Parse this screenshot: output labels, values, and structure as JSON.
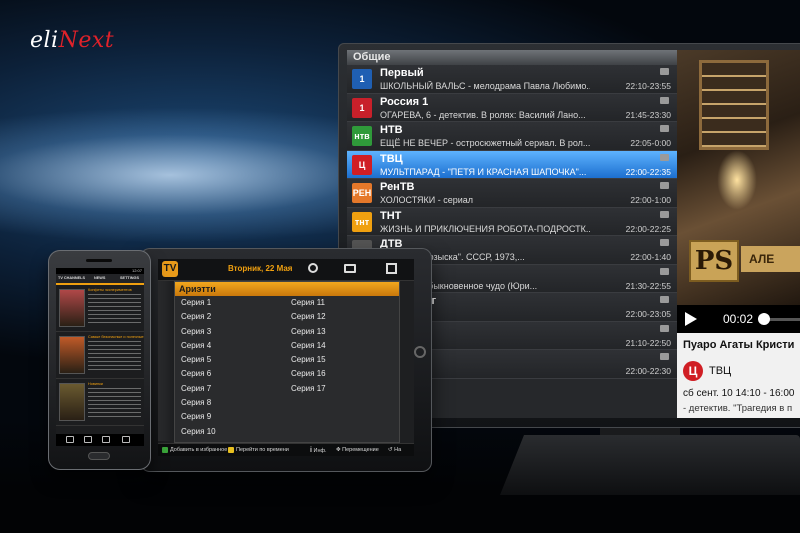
{
  "brand": {
    "logo_prefix": "eli",
    "logo_suffix": "Next"
  },
  "tv": {
    "list_header": "Общие",
    "channels": [
      {
        "name": "Первый",
        "program": "ШКОЛЬНЫЙ ВАЛЬС - мелодрама Павла Любимо...",
        "time": "22:10-23:55",
        "icon_text": "1",
        "icon_color": "#1f5fb3"
      },
      {
        "name": "Россия 1",
        "program": "ОГАРЕВА, 6 - детектив. В ролях: Василий Лано...",
        "time": "21:45-23:30",
        "icon_text": "1",
        "icon_color": "#c8202a"
      },
      {
        "name": "НТВ",
        "program": "ЕЩЁ НЕ ВЕЧЕР - остросюжетный сериал. В рол...",
        "time": "22:05-0:00",
        "icon_text": "нтв",
        "icon_color": "#2f9a3a"
      },
      {
        "name": "ТВЦ",
        "program": "МУЛЬТПАРАД - \"ПЕТЯ И КРАСНАЯ ШАПОЧКА\"...",
        "time": "22:00-22:35",
        "icon_text": "Ц",
        "icon_color": "#d01e24"
      },
      {
        "name": "РенТВ",
        "program": "ХОЛОСТЯКИ - сериал",
        "time": "22:00-1:00",
        "icon_text": "РЕН",
        "icon_color": "#e5782a"
      },
      {
        "name": "ТНТ",
        "program": "ЖИЗНЬ И ПРИКЛЮЧЕНИЯ РОБОТА-ПОДРОСТК...",
        "time": "22:00-22:25",
        "icon_text": "тнт",
        "icon_color": "#f0a010"
      },
      {
        "name": "ДТВ",
        "program": "головного розыска\". СССР, 1973,...",
        "time": "22:00-1:40",
        "icon_text": "дтв",
        "icon_color": "#555555"
      },
      {
        "name": "",
        "program": "сериал\". \"Обыкновенное чудо (Юри...",
        "time": "21:30-22:55",
        "icon_text": "",
        "icon_color": "#444444"
      },
      {
        "name": "Петербург",
        "program": "",
        "time": "22:00-23:05",
        "icon_text": "",
        "icon_color": "#444444"
      },
      {
        "name": "",
        "program": "Семёрке\".",
        "time": "21:10-22:50",
        "icon_text": "",
        "icon_color": "#444444"
      },
      {
        "name": "hion",
        "program": "",
        "time": "22:00-22:30",
        "icon_text": "",
        "icon_color": "#444444"
      }
    ],
    "selected_index": 3,
    "video": {
      "logo_letters": "PS",
      "label": "АЛЕ"
    },
    "player": {
      "time": "00:02"
    },
    "info": {
      "title": "Пуаро Агаты Кристи",
      "channel_logo": "Ц",
      "channel": "ТВЦ",
      "when": "сб сент. 10 14:10 - 16:00",
      "desc": "- детектив. \"Трагедия в п"
    }
  },
  "tablet": {
    "app_icon": "TV",
    "date": "Вторник, 22 Мая",
    "panel_header": "Ариэтти",
    "col1": [
      "Серия 1",
      "Серия 2",
      "Серия 3",
      "Серия 4",
      "Серия 5",
      "Серия 6",
      "Серия 7",
      "Серия 8",
      "Серия 9",
      "Серия 10"
    ],
    "col2": [
      "Серия 11",
      "Серия 12",
      "Серия 13",
      "Серия 14",
      "Серия 15",
      "Серия 16",
      "Серия 17"
    ],
    "bottom": {
      "fav": "Добавить в избранное",
      "goto": "Перейти по времени",
      "info": "Инф.",
      "move": "Перемещение",
      "back": "На"
    },
    "colors": {
      "accent": "#f0a010",
      "fav": "#3aa53a",
      "goto": "#e8c020"
    }
  },
  "phone": {
    "status_time": "12:07",
    "tabs": [
      "TV CHANNELS",
      "NEWS",
      "SETTINGS"
    ],
    "items": [
      {
        "title": "Конфеты экспериментов",
        "thumb": "#b04848"
      },
      {
        "title": "Самые безопасные и полезные",
        "thumb": "#c05a28"
      },
      {
        "title": "Новинки",
        "thumb": "#6a5a30"
      }
    ]
  }
}
